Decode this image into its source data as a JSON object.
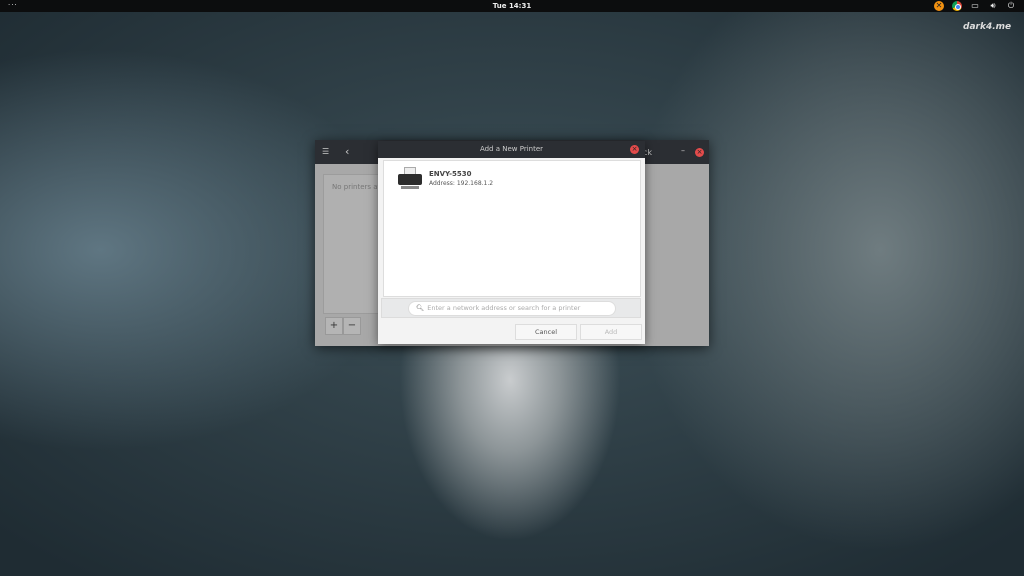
{
  "topbar": {
    "activities": "···",
    "clock": "Tue 14:31",
    "tray": [
      "crossover-icon",
      "chrome-icon",
      "display-icon",
      "volume-icon",
      "power-icon"
    ]
  },
  "watermark": "dark4.me",
  "printers_window": {
    "title_fragment": "ck",
    "empty_text": "No printers ava",
    "add": "+",
    "remove": "−",
    "minimize": "–",
    "close": "×",
    "back": "‹",
    "menu": "☰"
  },
  "dialog": {
    "title": "Add a New Printer",
    "close": "×",
    "printers": [
      {
        "name": "ENVY-5530",
        "address": "Address: 192.168.1.2"
      }
    ],
    "search_placeholder": "Enter a network address or search for a printer",
    "cancel": "Cancel",
    "add": "Add"
  },
  "colors": {
    "close": "#e34b4b",
    "titlebar": "#2b2e33"
  }
}
